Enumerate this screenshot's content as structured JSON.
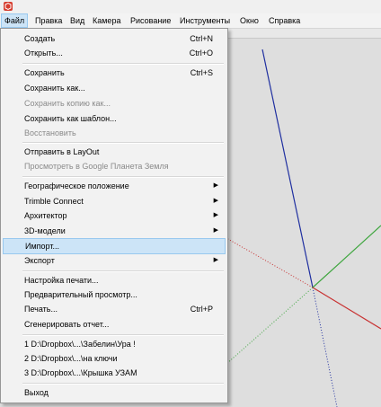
{
  "menubar": {
    "items": [
      {
        "label": "Файл",
        "active": true
      },
      {
        "label": "Правка"
      },
      {
        "label": "Вид"
      },
      {
        "label": "Камера"
      },
      {
        "label": "Рисование"
      },
      {
        "label": "Инструменты"
      },
      {
        "label": "Окно"
      },
      {
        "label": "Справка"
      }
    ]
  },
  "file_menu": {
    "items": [
      {
        "label": "Создать",
        "shortcut": "Ctrl+N"
      },
      {
        "label": "Открыть...",
        "shortcut": "Ctrl+O"
      },
      {
        "label": "Сохранить",
        "shortcut": "Ctrl+S"
      },
      {
        "label": "Сохранить как..."
      },
      {
        "label": "Сохранить копию как...",
        "disabled": true
      },
      {
        "label": "Сохранить как шаблон..."
      },
      {
        "label": "Восстановить",
        "disabled": true
      },
      {
        "label": "Отправить в LayOut"
      },
      {
        "label": "Просмотреть в Google Планета Земля",
        "disabled": true
      },
      {
        "label": "Географическое положение",
        "submenu": true
      },
      {
        "label": "Trimble Connect",
        "submenu": true
      },
      {
        "label": "Архитектор",
        "submenu": true
      },
      {
        "label": "3D-модели",
        "submenu": true
      },
      {
        "label": "Импорт...",
        "highlighted": true
      },
      {
        "label": "Экспорт",
        "submenu": true
      },
      {
        "label": "Настройка печати..."
      },
      {
        "label": "Предварительный просмотр..."
      },
      {
        "label": "Печать...",
        "shortcut": "Ctrl+P"
      },
      {
        "label": "Сгенерировать отчет..."
      },
      {
        "label": "1 D:\\Dropbox\\...\\Забелин\\Ура !"
      },
      {
        "label": "2 D:\\Dropbox\\...\\на ключи"
      },
      {
        "label": "3 D:\\Dropbox\\...\\Крышка УЗАМ"
      },
      {
        "label": "Выход"
      }
    ]
  },
  "colors": {
    "highlight": "#cce4f7",
    "axis_blue": "#1f2fa0",
    "axis_green": "#3fa63f",
    "axis_red": "#c83232"
  }
}
